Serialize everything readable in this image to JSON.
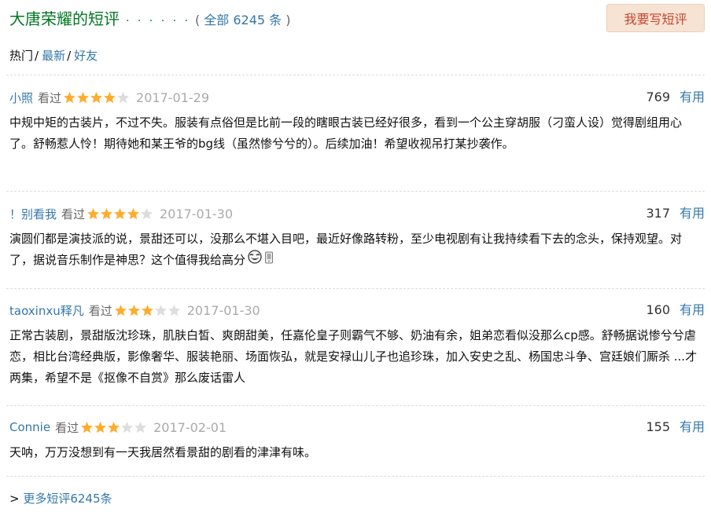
{
  "header": {
    "title": "大唐荣耀的短评",
    "dots": "· · · · · ·",
    "count_open": "( ",
    "count_link": "全部 6245 条",
    "count_close": " )",
    "write_button": "我要写短评"
  },
  "sort": {
    "hot": "热门",
    "newest": "最新",
    "friends": "好友",
    "sep": "/"
  },
  "comments": [
    {
      "user": "小照",
      "watched": "看过",
      "rating": 4,
      "date": "2017-01-29",
      "votes": "769",
      "useful": "有用",
      "text": "中规中矩的古装片，不过不失。服装有点俗但是比前一段的瞎眼古装已经好很多，看到一个公主穿胡服（刁蛮人设）觉得剧组用心了。舒畅惹人怜！期待她和某王爷的bg线（虽然惨兮兮的）。后续加油！希望收视吊打某抄袭作。"
    },
    {
      "user": "！别看我",
      "watched": "看过",
      "rating": 4,
      "date": "2017-01-30",
      "votes": "317",
      "useful": "有用",
      "text": "演圆们都是演技派的说，景甜还可以，没那么不堪入目吧，最近好像路转粉，至少电视剧有让我持续看下去的念头，保持观望。对了，据说音乐制作是神思？这个值得我给高分"
    },
    {
      "user": "taoxinxu释凡",
      "watched": "看过",
      "rating": 3,
      "date": "2017-01-30",
      "votes": "160",
      "useful": "有用",
      "text": "正常古装剧，景甜版沈珍珠，肌肤白皙、爽朗甜美，任嘉伦皇子则霸气不够、奶油有余，姐弟恋看似没那么cp感。舒畅据说惨兮兮虐恋，相比台湾经典版，影像奢华、服装艳丽、场面恢弘，就是安禄山儿子也追珍珠，加入安史之乱、杨国忠斗争、宫廷娘们厮杀 ...才两集，希望不是《抠像不自赏》那么废话雷人"
    },
    {
      "user": "Connie",
      "watched": "看过",
      "rating": 3,
      "date": "2017-02-01",
      "votes": "155",
      "useful": "有用",
      "text": "天呐，万万没想到有一天我居然看景甜的剧看的津津有味。"
    }
  ],
  "more": {
    "prefix": "> ",
    "link": "更多短评6245条"
  },
  "colors": {
    "title_green": "#007722",
    "link_blue": "#3377aa",
    "star_gold": "#ffac2d",
    "star_gray": "#dddddd",
    "button_bg": "#f7e3d3",
    "button_text": "#c4462f"
  }
}
